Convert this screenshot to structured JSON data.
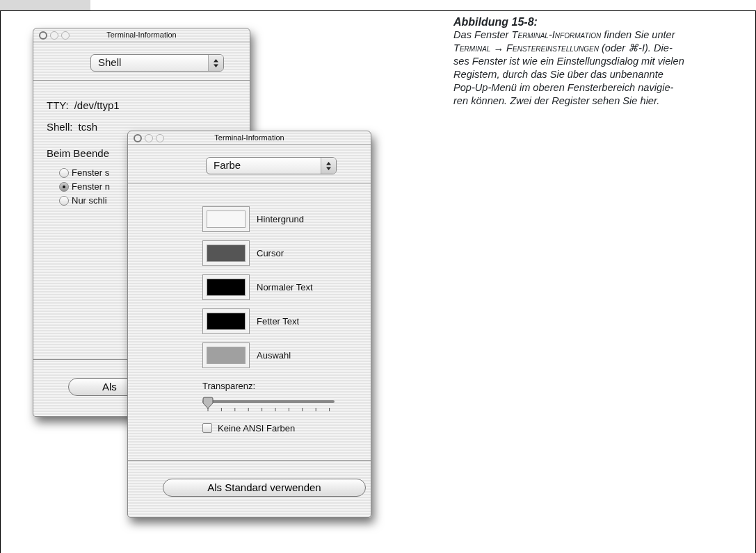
{
  "back_window": {
    "title": "Terminal-Information",
    "popup": "Shell",
    "info": [
      {
        "label": "TTY:",
        "value": "/dev/ttyp1"
      },
      {
        "label": "Shell:",
        "value": "tcsh"
      }
    ],
    "group_label": "Beim Beende",
    "radios": [
      {
        "label": "Fenster s",
        "selected": false
      },
      {
        "label": "Fenster n",
        "selected": true
      },
      {
        "label": "Nur schli",
        "selected": false
      }
    ],
    "button": "Als"
  },
  "front_window": {
    "title": "Terminal-Information",
    "popup": "Farbe",
    "colors": [
      {
        "label": "Hintergrund",
        "color": "#f7f7f7"
      },
      {
        "label": "Cursor",
        "color": "#555555"
      },
      {
        "label": "Normaler Text",
        "color": "#000000"
      },
      {
        "label": "Fetter Text",
        "color": "#000000"
      },
      {
        "label": "Auswahl",
        "color": "#a0a0a0"
      }
    ],
    "slider": {
      "label": "Transparenz:",
      "level": 0
    },
    "checkbox": {
      "label": "Keine ANSI Farben",
      "checked": false
    },
    "button": "Als Standard verwenden"
  },
  "caption": {
    "title": "Abbildung 15-8:",
    "lines": [
      [
        {
          "kind": "plain",
          "text": "Das Fenster "
        },
        {
          "kind": "smallcaps",
          "text": "Terminal-Information"
        },
        {
          "kind": "plain",
          "text": " finden Sie unter"
        }
      ],
      [
        {
          "kind": "smallcaps",
          "text": "Terminal"
        },
        {
          "kind": "plain",
          "text": " → "
        },
        {
          "kind": "smallcaps",
          "text": "Fenstereinstellungen"
        },
        {
          "kind": "plain",
          "text": " (oder ⌘-I). Die-"
        }
      ],
      [
        {
          "kind": "plain",
          "text": "ses Fenster ist wie ein Einstellungsdialog mit vielen"
        }
      ],
      [
        {
          "kind": "plain",
          "text": "Registern, durch das Sie über das unbenannte"
        }
      ],
      [
        {
          "kind": "plain",
          "text": "Pop-Up-Menü im oberen Fensterbereich navigie-"
        }
      ],
      [
        {
          "kind": "plain",
          "text": "ren können. Zwei der Register sehen Sie hier."
        }
      ]
    ]
  }
}
